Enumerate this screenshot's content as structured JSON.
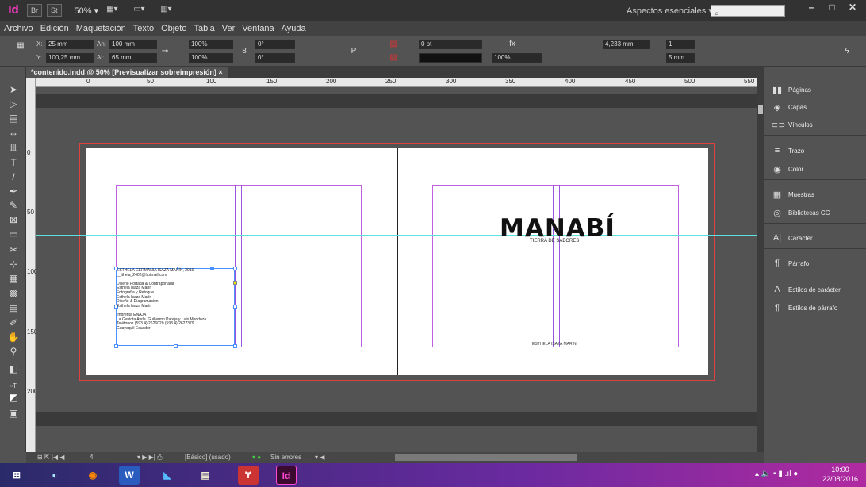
{
  "app": {
    "logo": "Id",
    "br_button": "Br",
    "st_button": "St",
    "zoom": "50% ▾",
    "workspace": "Aspectos esenciales ▾",
    "search_placeholder": ""
  },
  "menu": [
    "Archivo",
    "Edición",
    "Maquetación",
    "Texto",
    "Objeto",
    "Tabla",
    "Ver",
    "Ventana",
    "Ayuda"
  ],
  "control": {
    "x_label": "X:",
    "x_value": "25 mm",
    "y_label": "Y:",
    "y_value": "100,25 mm",
    "w_label": "An:",
    "w_value": "100 mm",
    "h_label": "Al:",
    "h_value": "65 mm",
    "scale_x": "100%",
    "scale_y": "100%",
    "angle": "0°",
    "shear": "0°",
    "stroke_weight": "0 pt",
    "opacity": "100%",
    "dimension": "4,233 mm",
    "columns": "1",
    "gutter": "5 mm"
  },
  "document": {
    "tab_label": "*contenido.indd @ 50% [Previsualizar sobreimpresión]",
    "ruler_h": [
      "0",
      "50",
      "100",
      "150",
      "200",
      "250",
      "300",
      "350",
      "400",
      "450",
      "500",
      "550"
    ],
    "ruler_v": [
      "0",
      "50",
      "100",
      "150",
      "200"
    ]
  },
  "left_page": {
    "colophon": [
      "ESTHELA GERMANIA ISAZA MARÍN, 2016",
      "__ithela_2402@hotmail.com",
      "",
      "Diseño Portada & Contraportada",
      "Esthela Isaza Marín",
      "Fotografía y Retoque",
      "Esthela Isaza Marín",
      "Diseño & Diagramación",
      "Esthela Isaza Marín",
      "",
      "Imprenta ENAJA",
      "La Gaviota Avda. Guillermo Pareja y Luis Mendoza",
      "Teléfonos (593 4) 2626020   (593 4) 2627379",
      "Guayaquil   Ecuador"
    ]
  },
  "right_page": {
    "title": "MANABÍ",
    "subtitle": "TIERRA DE SABORES",
    "author": "ESTHELA ISAZA MARÍN"
  },
  "panels": [
    {
      "icon": "pages-icon",
      "glyph": "▮▮",
      "label": "Páginas"
    },
    {
      "icon": "layers-icon",
      "glyph": "◈",
      "label": "Capas"
    },
    {
      "icon": "links-icon",
      "glyph": "⊂⊃",
      "label": "Vínculos"
    },
    {
      "icon": "stroke-icon",
      "glyph": "≡",
      "label": "Trazo"
    },
    {
      "icon": "color-icon",
      "glyph": "◉",
      "label": "Color"
    },
    {
      "icon": "swatches-icon",
      "glyph": "▦",
      "label": "Muestras"
    },
    {
      "icon": "cc-libraries-icon",
      "glyph": "◎",
      "label": "Bibliotecas CC"
    },
    {
      "icon": "character-icon",
      "glyph": "A|",
      "label": "Carácter"
    },
    {
      "icon": "paragraph-icon",
      "glyph": "¶",
      "label": "Párrafo"
    },
    {
      "icon": "character-styles-icon",
      "glyph": "A",
      "label": "Estilos de carácter"
    },
    {
      "icon": "paragraph-styles-icon",
      "glyph": "¶",
      "label": "Estilos de párrafo"
    }
  ],
  "status": {
    "page": "4",
    "master": "[Básico] (usado)",
    "preflight": "Sin errores"
  },
  "taskbar": {
    "time": "10:00",
    "date": "22/08/2016"
  }
}
